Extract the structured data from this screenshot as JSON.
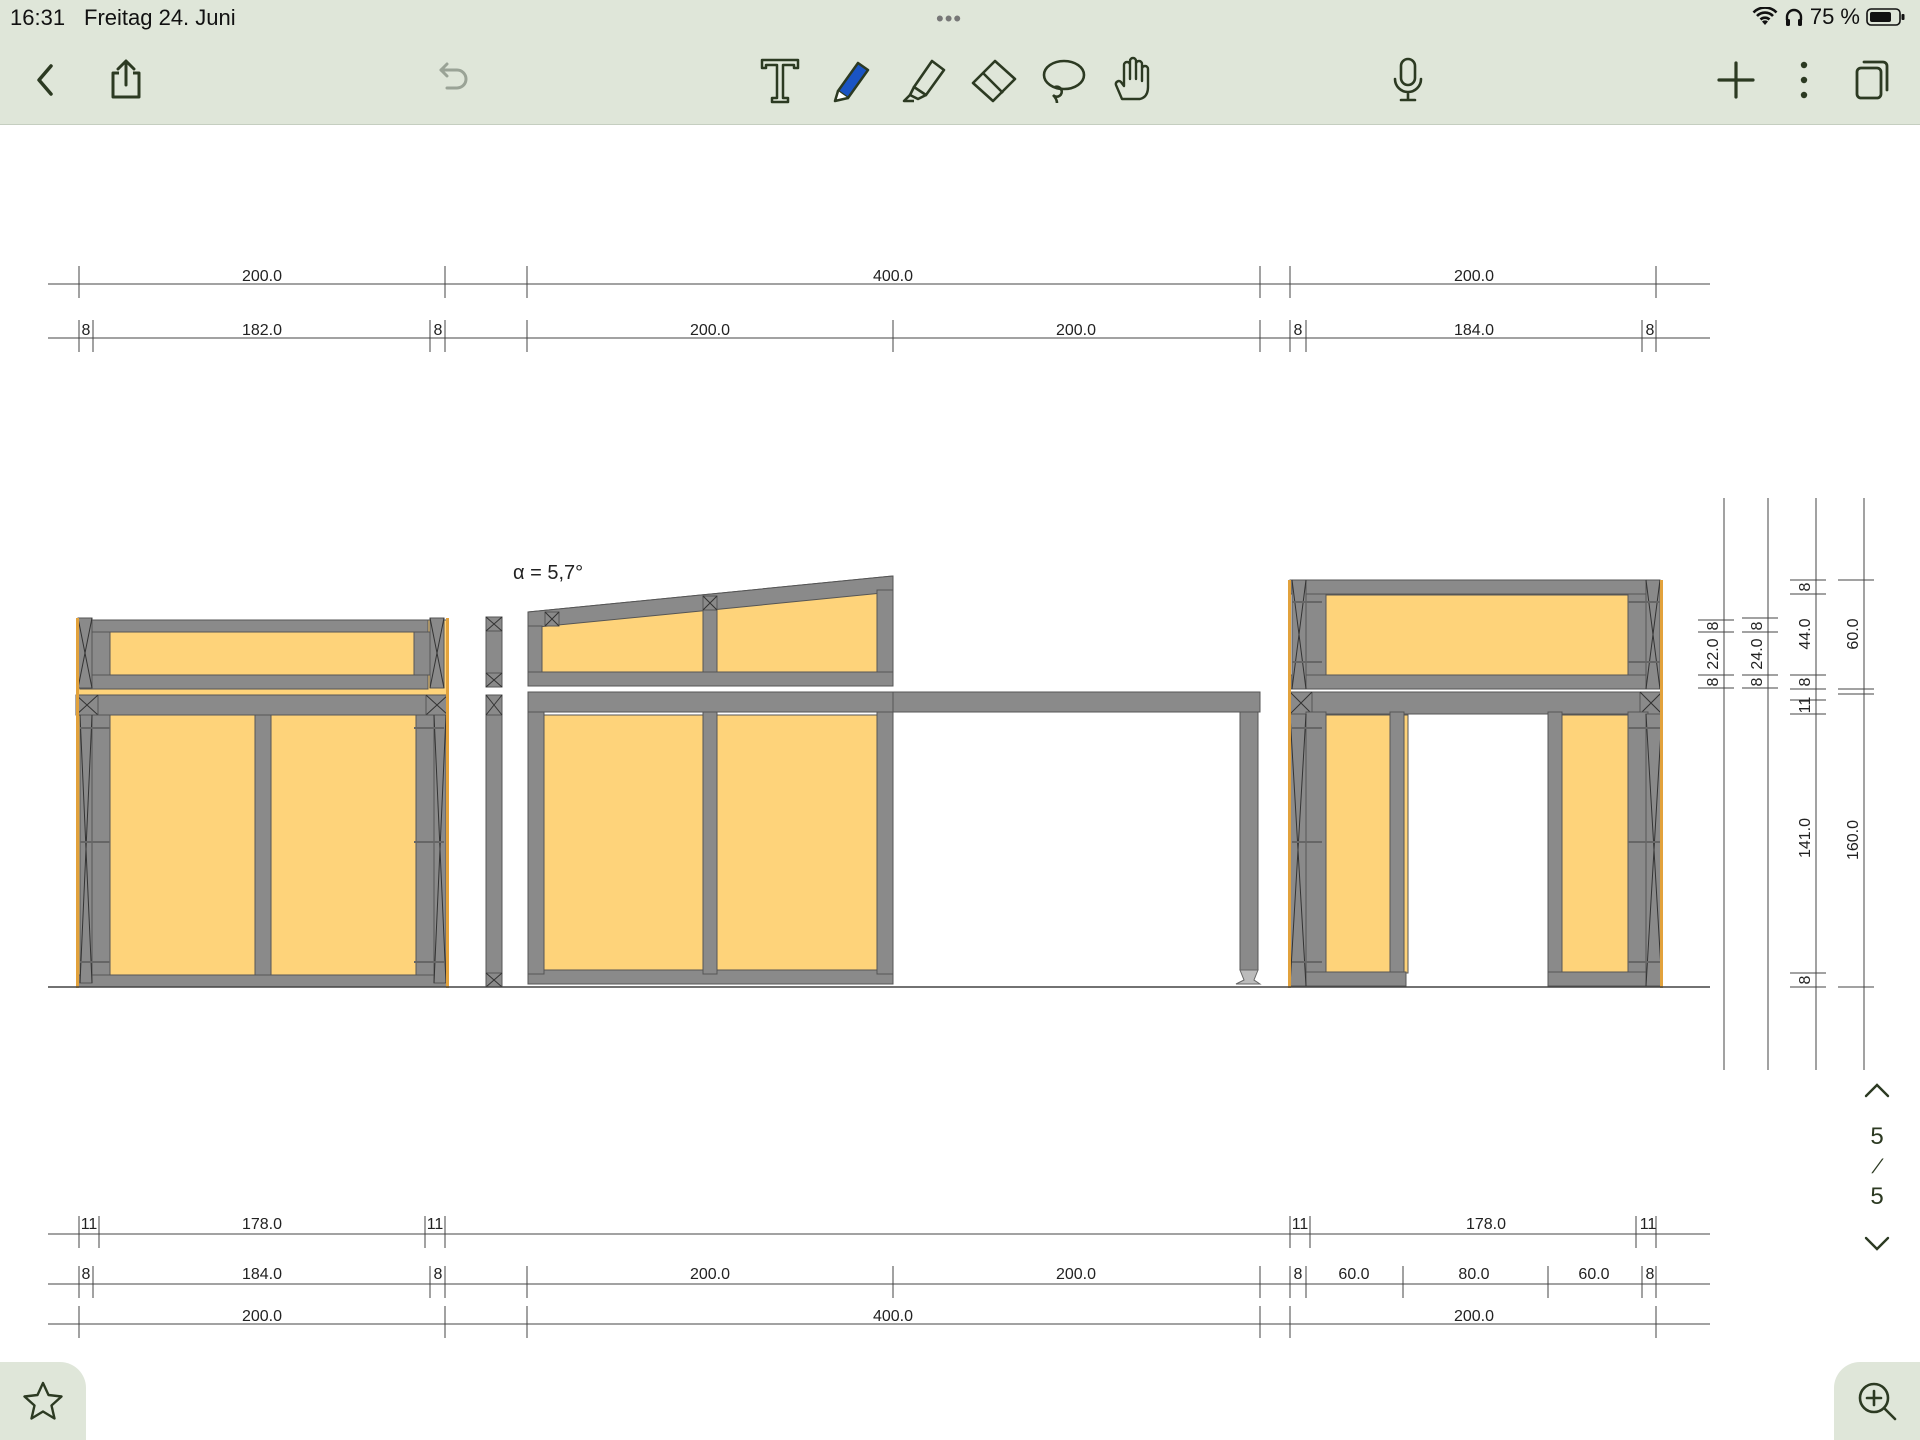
{
  "status": {
    "time": "16:31",
    "date": "Freitag 24. Juni",
    "battery": "75 %",
    "dots": "•••"
  },
  "toolbar": {
    "icons": [
      "back-icon",
      "share-icon",
      "undo-icon",
      "text-tool-icon",
      "pen-tool-icon",
      "highlighter-icon",
      "eraser-icon",
      "lasso-icon",
      "hand-tool-icon",
      "microphone-icon",
      "add-icon",
      "more-icon",
      "pages-icon"
    ]
  },
  "drawing": {
    "angle_label": "α = 5,7°",
    "top_dims_row1": [
      "200.0",
      "400.0",
      "200.0"
    ],
    "top_dims_row2": [
      "8",
      "182.0",
      "8",
      "200.0",
      "200.0",
      "8",
      "184.0",
      "8"
    ],
    "bottom_dims_row1": [
      "11",
      "178.0",
      "11",
      "11",
      "178.0",
      "11"
    ],
    "bottom_dims_row2": [
      "8",
      "184.0",
      "8",
      "200.0",
      "200.0",
      "8",
      "60.0",
      "80.0",
      "60.0",
      "8"
    ],
    "bottom_dims_row3": [
      "200.0",
      "400.0",
      "200.0"
    ],
    "right_dims_col1": [
      "8",
      "22.0",
      "8"
    ],
    "right_dims_col2": [
      "8",
      "24.0",
      "8"
    ],
    "right_dims_col3": [
      "8",
      "44.0",
      "8",
      "11",
      "141.0",
      "8"
    ],
    "right_dims_col4": [
      "60.0",
      "160.0"
    ],
    "colors": {
      "panel": "#fed37a",
      "beam": "#8a8a8a",
      "beam_edge": "#555555",
      "line": "#444444"
    }
  },
  "pager": {
    "current": "5",
    "separator": "/",
    "total": "5"
  }
}
